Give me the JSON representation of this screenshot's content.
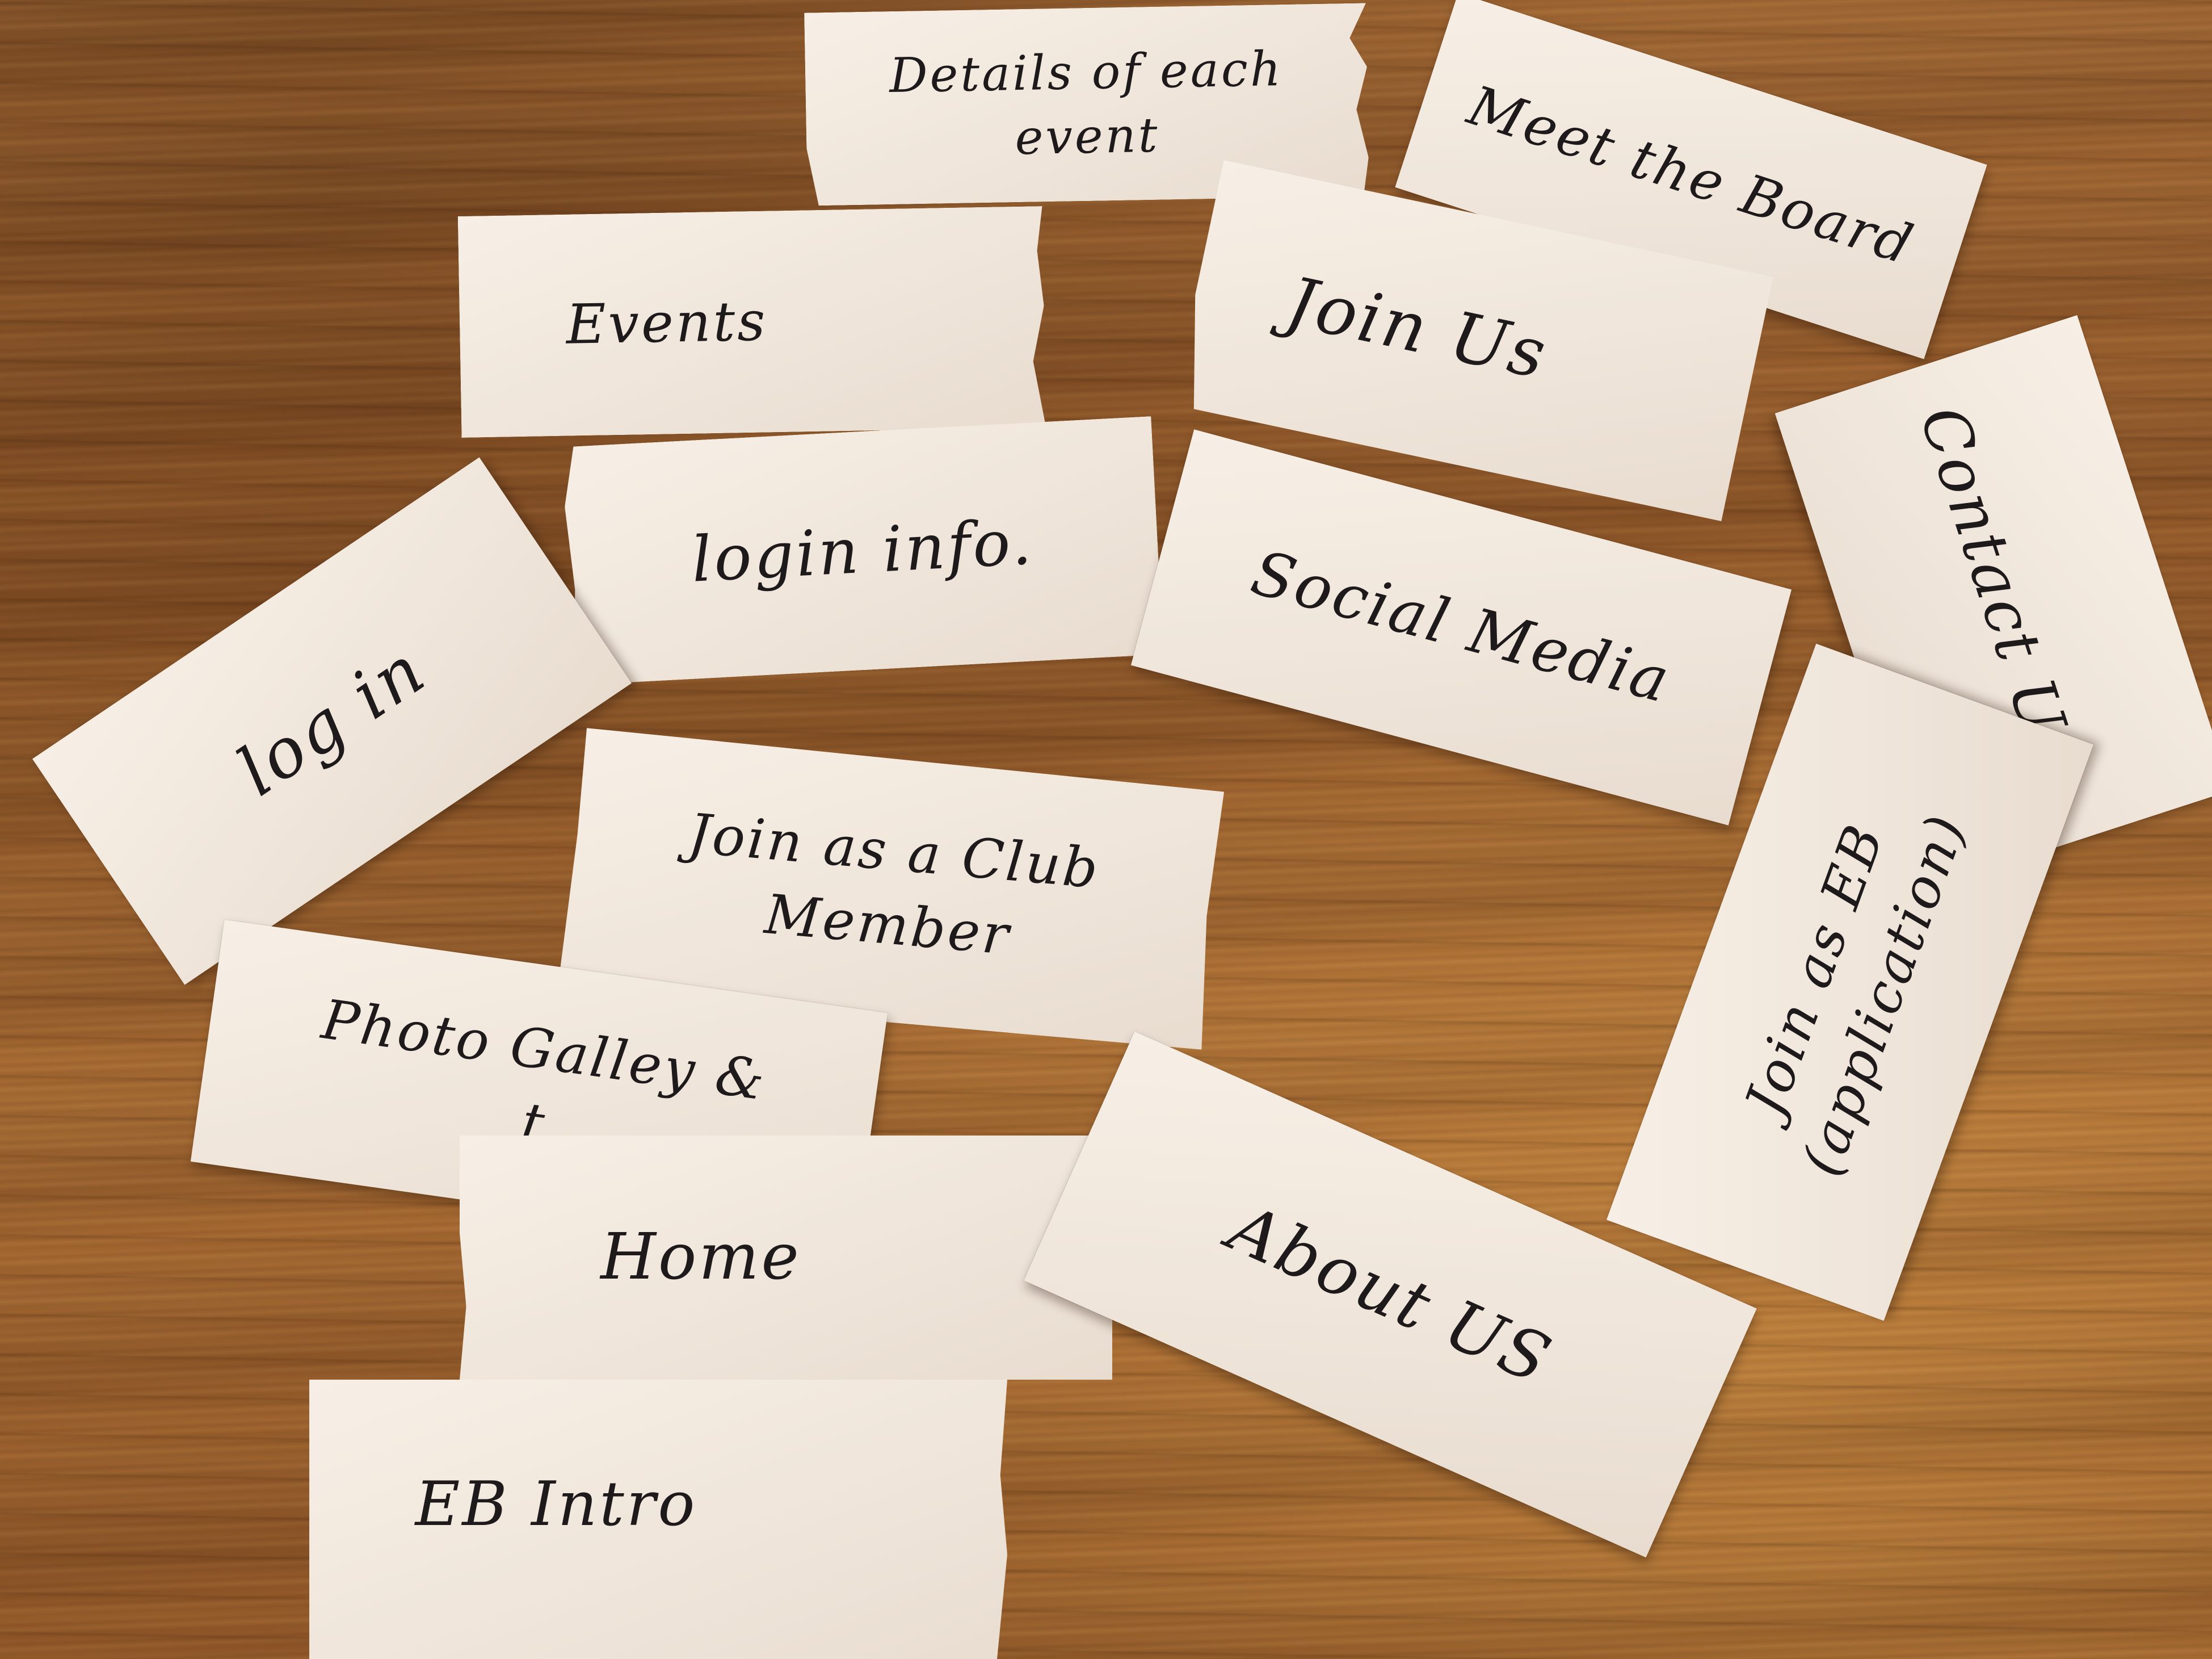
{
  "notes": {
    "details_of_each_event": "Details of each\nevent",
    "meet_the_board": "Meet the Board",
    "events": "Events",
    "join_us": "Join Us",
    "contact_us": "Contact US.",
    "login_info": "login info.",
    "social_media": "Social Media",
    "log_in": "log in",
    "join_as_club_member": "Join as a Club\nMember",
    "join_as_eb": "Join as EB\n(application)",
    "photo_gallery": "Photo Galley &\nt",
    "home": "Home",
    "about_us": "About US",
    "eb_intro": "EB Intro"
  },
  "colors": {
    "paper": "#f1e8de",
    "ink": "#1e1a1c",
    "wood": "#8c5528"
  }
}
